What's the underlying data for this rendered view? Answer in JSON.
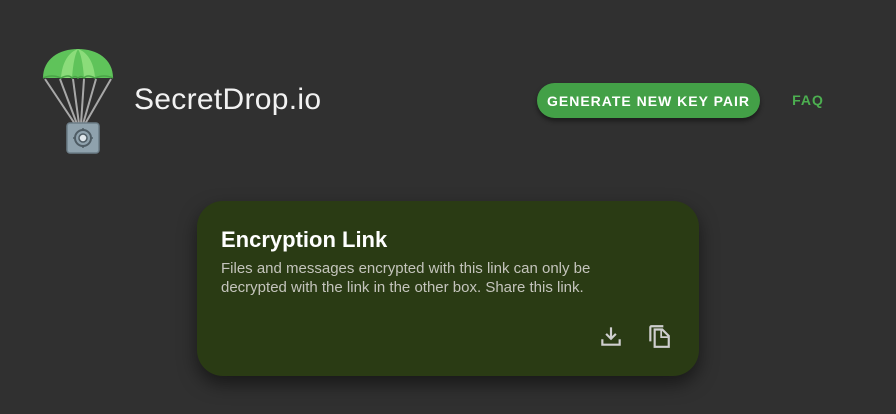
{
  "header": {
    "brand_name": "SecretDrop.io",
    "logo_icon": "parachute-safe-icon",
    "generate_button_label": "GENERATE NEW KEY PAIR",
    "faq_link_label": "FAQ"
  },
  "card": {
    "title": "Encryption Link",
    "description": "Files and messages encrypted with this link can only be decrypted with the link in the other box. Share this link.",
    "actions": [
      {
        "icon": "download-icon"
      },
      {
        "icon": "copy-icon"
      }
    ]
  },
  "colors": {
    "background": "#303030",
    "accent_green": "#43a047",
    "faq_green": "#4caf50",
    "card_background": "#2a3b14"
  }
}
